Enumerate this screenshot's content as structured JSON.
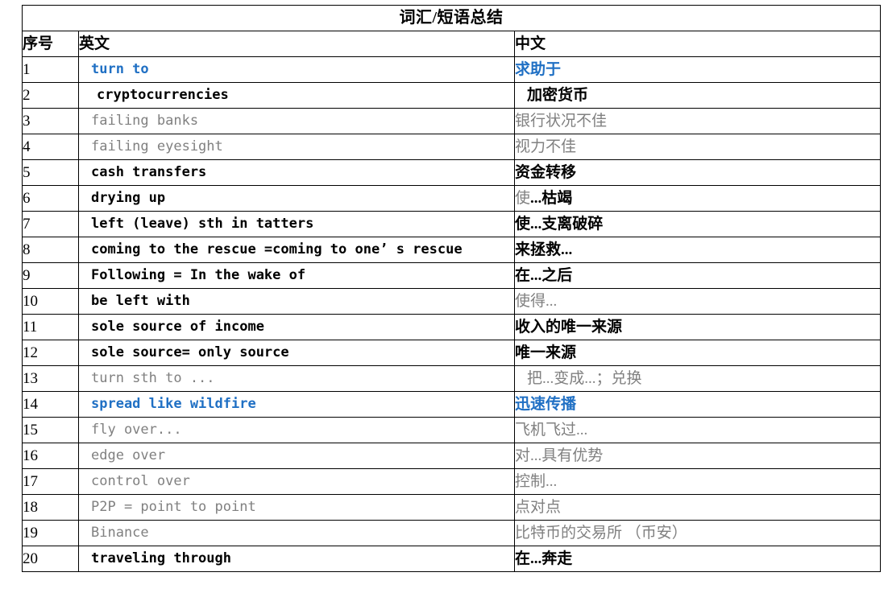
{
  "document": {
    "title": "词汇/短语总结",
    "columns": {
      "index": "序号",
      "english": "英文",
      "chinese": "中文"
    }
  },
  "colors": {
    "highlight_blue": "#2070c4",
    "muted_gray": "#808080",
    "default_black": "#000000",
    "border": "#000000"
  },
  "rows": [
    {
      "no": "1",
      "en": "turn to",
      "zh": "求助于"
    },
    {
      "no": "2",
      "en": "cryptocurrencies",
      "zh": "加密货币"
    },
    {
      "no": "3",
      "en": "failing banks",
      "zh": "银行状况不佳"
    },
    {
      "no": "4",
      "en": "failing  eyesight",
      "zh": "视力不佳"
    },
    {
      "no": "5",
      "en": "cash transfers",
      "zh": "资金转移"
    },
    {
      "no": "6",
      "en": "drying up",
      "zh": "使...枯竭",
      "zh_prefix": "使",
      "zh_suffix": "...枯竭"
    },
    {
      "no": "7",
      "en": "left (leave) sth in tatters",
      "zh": "使...支离破碎"
    },
    {
      "no": "8",
      "en": "coming to the rescue =coming to one’ s rescue",
      "zh": "来拯救..."
    },
    {
      "no": "9",
      "en": "Following = In the wake of",
      "zh": "在...之后"
    },
    {
      "no": "10",
      "en": "be left with",
      "zh": "使得..."
    },
    {
      "no": "11",
      "en": "sole source of income",
      "zh": "收入的唯一来源"
    },
    {
      "no": "12",
      "en": "sole source= only source",
      "zh": "唯一来源"
    },
    {
      "no": "13",
      "en": "turn sth to ...",
      "zh": "把...变成...；兑换"
    },
    {
      "no": "14",
      "en": "spread like wildfire",
      "zh": "迅速传播"
    },
    {
      "no": "15",
      "en": "fly over...",
      "zh": "飞机飞过..."
    },
    {
      "no": "16",
      "en": "edge over",
      "zh": "对...具有优势"
    },
    {
      "no": "17",
      "en": "control over",
      "zh": "控制..."
    },
    {
      "no": "18",
      "en": "P2P = point to point",
      "zh": "点对点"
    },
    {
      "no": "19",
      "en": "Binance",
      "zh": "比特币的交易所 （币安）"
    },
    {
      "no": "20",
      "en": "traveling through",
      "zh": "在...奔走"
    }
  ]
}
